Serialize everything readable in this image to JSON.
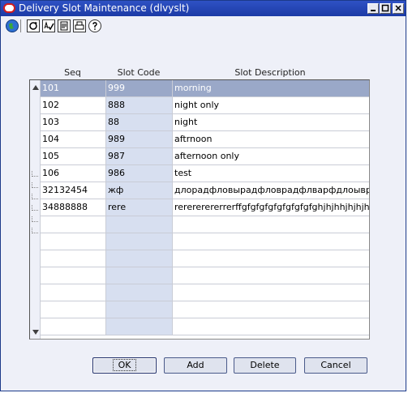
{
  "window": {
    "title": "Delivery Slot Maintenance (dlvyslt)"
  },
  "toolbar": {
    "icons": [
      "globe-icon",
      "refresh-icon",
      "spellcheck-icon",
      "document-icon",
      "print-icon",
      "help-icon"
    ]
  },
  "table": {
    "columns": [
      "Seq",
      "Slot Code",
      "Slot Description"
    ],
    "rows": [
      {
        "seq": "101",
        "code": "999",
        "desc": "morning"
      },
      {
        "seq": "102",
        "code": "888",
        "desc": " night only"
      },
      {
        "seq": "103",
        "code": "88",
        "desc": "night"
      },
      {
        "seq": "104",
        "code": "989",
        "desc": "aftrnoon"
      },
      {
        "seq": "105",
        "code": "987",
        "desc": "afternoon only"
      },
      {
        "seq": "106",
        "code": "986",
        "desc": "test"
      },
      {
        "seq": "32132454",
        "code": "жф",
        "desc": "длорадфловырадфловрадфлварфдлоывради"
      },
      {
        "seq": "34888888",
        "code": "rere",
        "desc": "rerererererrerffgfgfgfgfgfgfgfgfghjhjhhjhjhjhh"
      },
      {
        "seq": "",
        "code": "",
        "desc": ""
      },
      {
        "seq": "",
        "code": "",
        "desc": ""
      },
      {
        "seq": "",
        "code": "",
        "desc": ""
      },
      {
        "seq": "",
        "code": "",
        "desc": ""
      },
      {
        "seq": "",
        "code": "",
        "desc": ""
      },
      {
        "seq": "",
        "code": "",
        "desc": ""
      },
      {
        "seq": "",
        "code": "",
        "desc": ""
      }
    ],
    "selected_row": 0
  },
  "buttons": {
    "ok": "OK",
    "add": "Add",
    "delete": "Delete",
    "cancel": "Cancel"
  },
  "colors": {
    "title_bar": "#1b3aa6",
    "selection": "#9aa8c8",
    "code_column": "#d7dff0"
  }
}
